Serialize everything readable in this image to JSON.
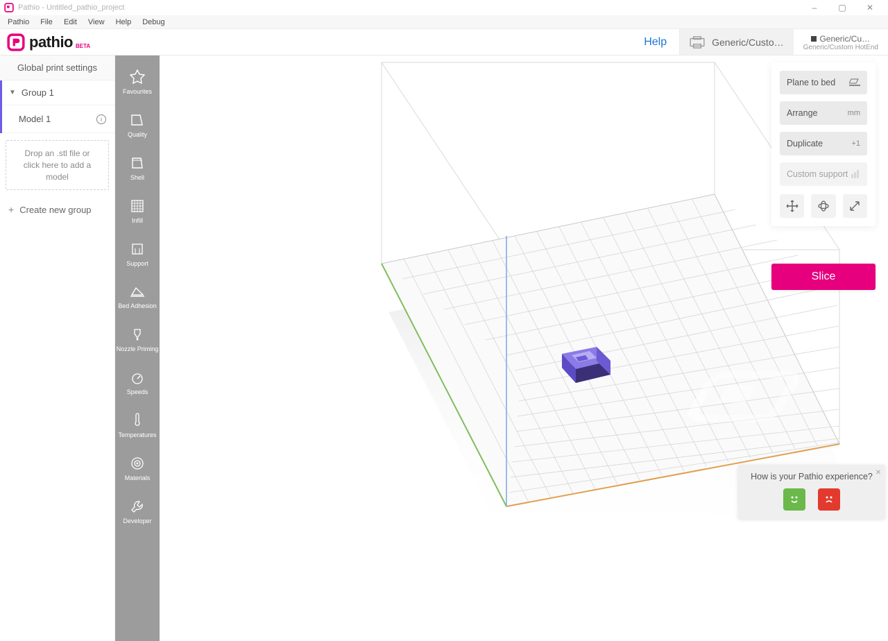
{
  "window": {
    "title": "Pathio - Untitled_pathio_project"
  },
  "menubar": [
    "Pathio",
    "File",
    "Edit",
    "View",
    "Help",
    "Debug"
  ],
  "toolbar": {
    "logo_text": "pathio",
    "logo_beta": "BETA",
    "help_label": "Help",
    "printer_name": "Generic/Custo…",
    "extruder_top": "Generic/Cu…",
    "extruder_sub": "Generic/Custom HotEnd"
  },
  "left_panel": {
    "header": "Global print settings",
    "group_name": "Group 1",
    "model_name": "Model 1",
    "drop_line1": "Drop an .stl file or",
    "drop_line2": "click here to add a model",
    "create_group": "Create new group"
  },
  "rail": [
    {
      "id": "favourites",
      "label": "Favourites",
      "icon": "star"
    },
    {
      "id": "quality",
      "label": "Quality",
      "icon": "quality"
    },
    {
      "id": "shell",
      "label": "Shell",
      "icon": "shell"
    },
    {
      "id": "infill",
      "label": "Infill",
      "icon": "infill"
    },
    {
      "id": "support",
      "label": "Support",
      "icon": "support"
    },
    {
      "id": "bed-adhesion",
      "label": "Bed Adhesion",
      "icon": "bed"
    },
    {
      "id": "nozzle-priming",
      "label": "Nozzle Priming",
      "icon": "nozzle"
    },
    {
      "id": "speeds",
      "label": "Speeds",
      "icon": "speed"
    },
    {
      "id": "temperatures",
      "label": "Temperatures",
      "icon": "temp"
    },
    {
      "id": "materials",
      "label": "Materials",
      "icon": "material"
    },
    {
      "id": "developer",
      "label": "Developer",
      "icon": "dev"
    }
  ],
  "right_panel": {
    "plane_to_bed": "Plane to bed",
    "arrange": "Arrange",
    "arrange_unit": "mm",
    "duplicate": "Duplicate",
    "duplicate_sub": "+1",
    "custom_support": "Custom support",
    "slice": "Slice"
  },
  "feedback": {
    "question": "How is your Pathio experience?"
  }
}
